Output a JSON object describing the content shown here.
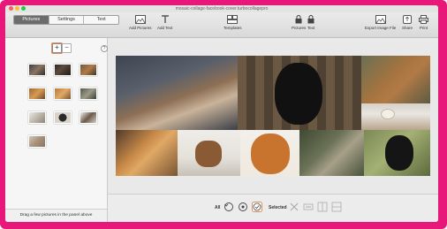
{
  "window": {
    "title": "mosaic-collage-facebook-cover.turbocollagepro"
  },
  "tabs": [
    {
      "label": "Pictures",
      "active": true
    },
    {
      "label": "Settings",
      "active": false
    },
    {
      "label": "Text",
      "active": false
    }
  ],
  "toolbar": {
    "add_pictures": "Add Pictures",
    "add_text": "Add Text",
    "templates": "Templates",
    "pictures_lock": "Pictures",
    "text_lock": "Text",
    "export": "Export Image File",
    "share": "Share",
    "print": "Print"
  },
  "sidebar": {
    "add_symbol": "+",
    "remove_symbol": "−",
    "help_symbol": "?",
    "footer": "Drag a few pictures in the panel above",
    "thumbnail_count": 10
  },
  "bottombar": {
    "all_label": "All",
    "selected_label": "Selected"
  },
  "colors": {
    "frame": "#e8177a",
    "active_tab": "#6c6c6c",
    "highlight_ring": "#d9905a"
  }
}
